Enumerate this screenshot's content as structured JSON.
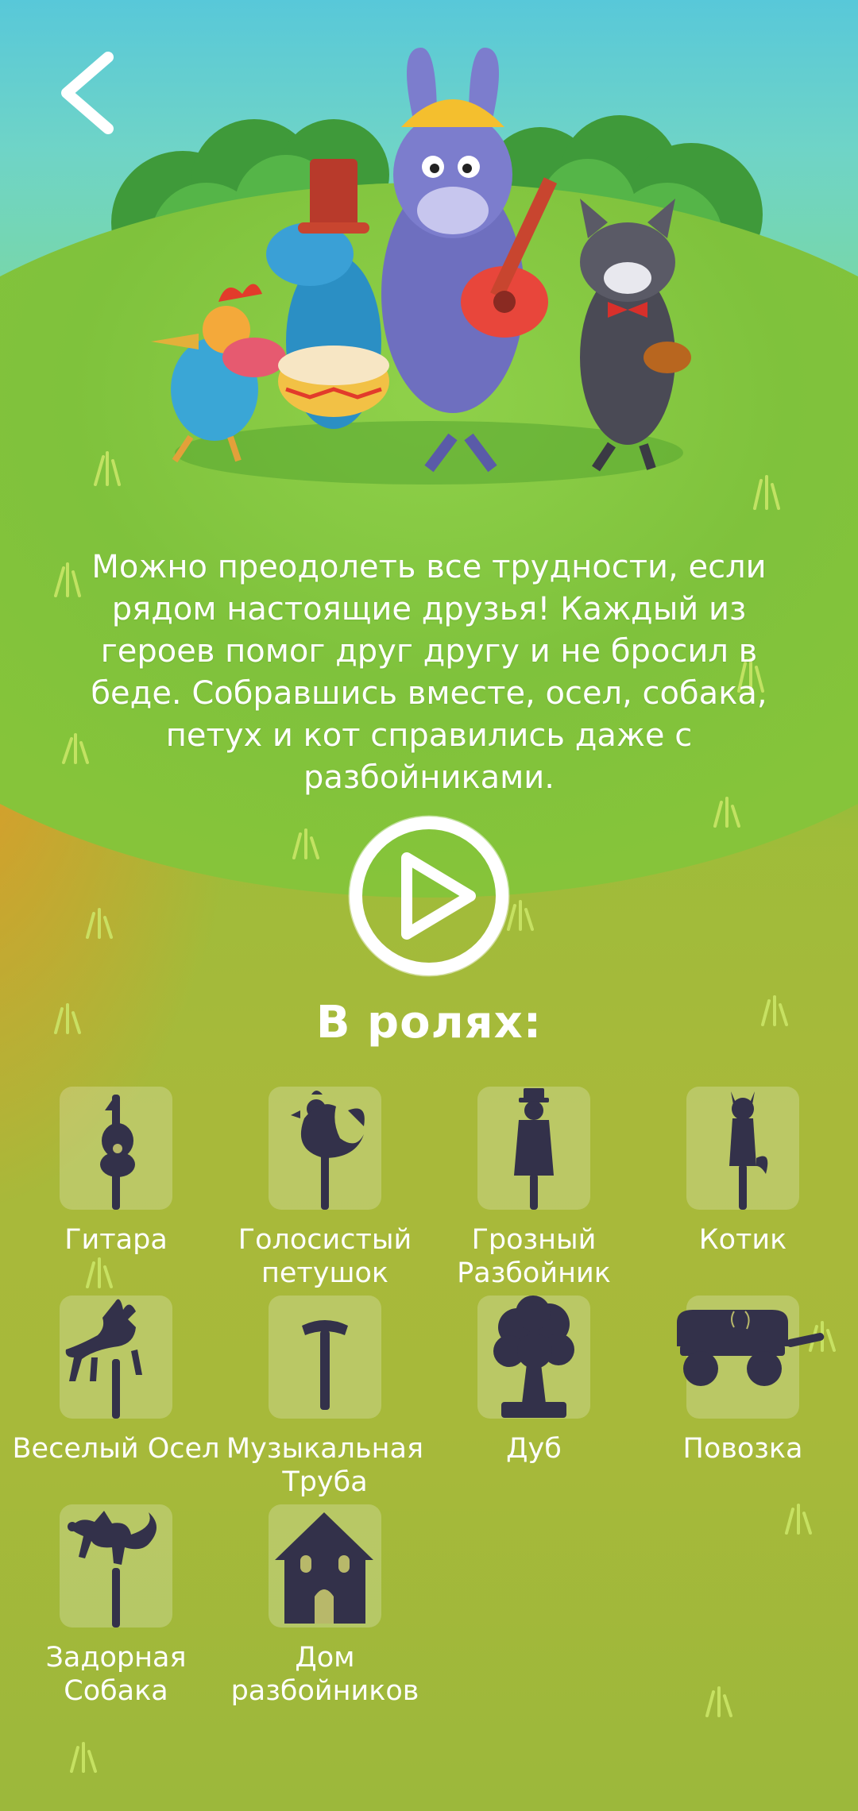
{
  "nav": {
    "back_icon": "chevron-left-icon"
  },
  "story": {
    "description": "Можно преодолеть все трудности, если рядом настоящие друзья! Каждый из героев помог друг другу и не бросил в беде. Собравшись вместе, осел, собака, петух и кот справились даже с разбойниками."
  },
  "player": {
    "play_icon": "play-icon"
  },
  "cast": {
    "title": "В ролях:",
    "items": [
      {
        "label": "Гитара",
        "icon": "guitar-icon"
      },
      {
        "label": "Голосистый петушок",
        "icon": "rooster-icon"
      },
      {
        "label": "Грозный Разбойник",
        "icon": "robber-icon"
      },
      {
        "label": "Котик",
        "icon": "cat-icon"
      },
      {
        "label": "Веселый Осел",
        "icon": "donkey-icon"
      },
      {
        "label": "Музыкальная Труба",
        "icon": "trumpet-icon"
      },
      {
        "label": "Дуб",
        "icon": "oak-icon"
      },
      {
        "label": "Повозка",
        "icon": "cart-icon"
      },
      {
        "label": "Задорная Собака",
        "icon": "dog-icon"
      },
      {
        "label": "Дом разбойников",
        "icon": "house-icon"
      }
    ]
  },
  "colors": {
    "silhouette": "#33314a",
    "tile": "rgba(255,255,255,0.22)",
    "text": "#ffffff"
  }
}
